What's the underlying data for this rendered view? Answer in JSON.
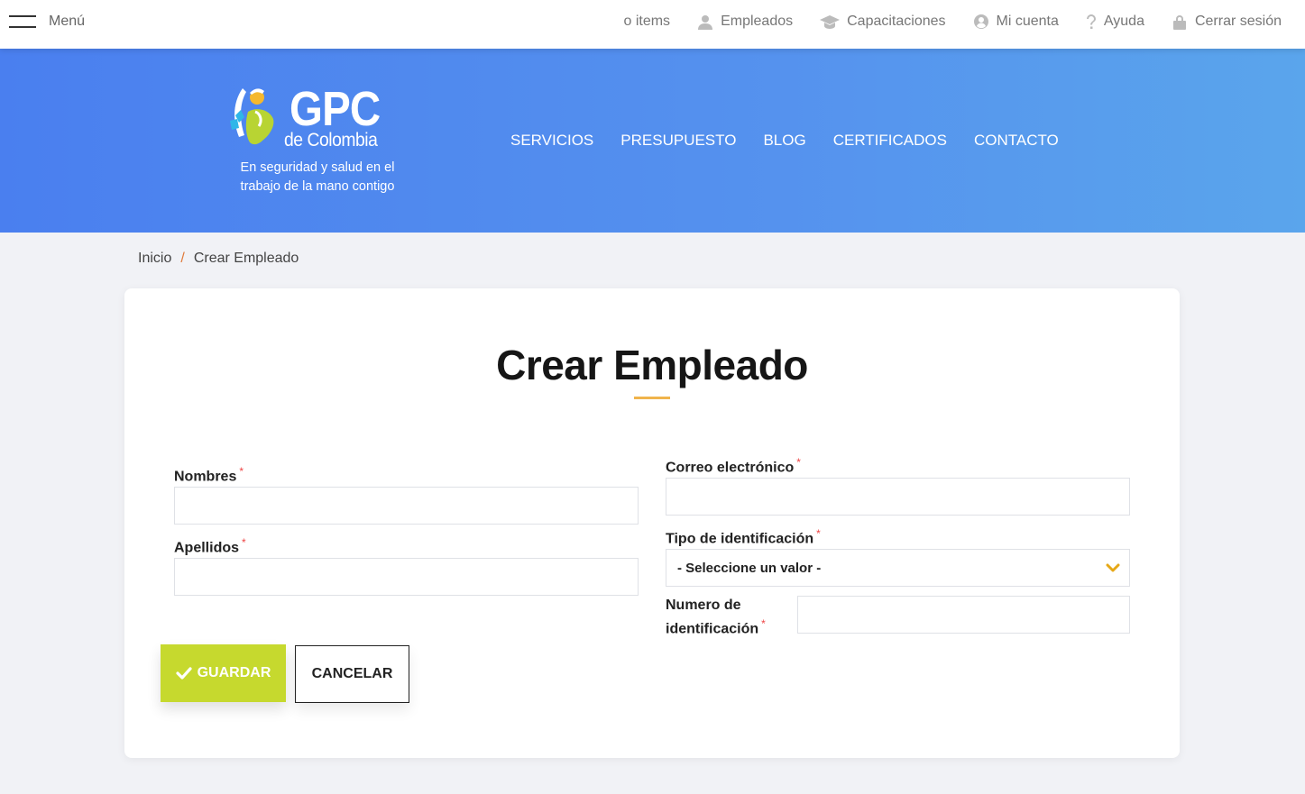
{
  "topbar": {
    "menu_label": "Menú",
    "links": [
      {
        "label": "o items",
        "icon": "none"
      },
      {
        "label": "Empleados",
        "icon": "user-icon"
      },
      {
        "label": "Capacitaciones",
        "icon": "graduation-cap-icon"
      },
      {
        "label": "Mi cuenta",
        "icon": "user-circle-icon"
      },
      {
        "label": "Ayuda",
        "icon": "question-icon"
      },
      {
        "label": "Cerrar sesión",
        "icon": "lock-icon"
      }
    ]
  },
  "header": {
    "logo_word": "GPC",
    "logo_sub": "de Colombia",
    "tagline": "En seguridad y salud en el trabajo de la mano contigo",
    "nav": [
      "SERVICIOS",
      "PRESUPUESTO",
      "BLOG",
      "CERTIFICADOS",
      "CONTACTO"
    ]
  },
  "breadcrumb": {
    "home": "Inicio",
    "separator": "/",
    "current": "Crear Empleado"
  },
  "form": {
    "title": "Crear Empleado",
    "required_mark": "*",
    "nombres_label": "Nombres",
    "nombres_value": "",
    "apellidos_label": "Apellidos",
    "apellidos_value": "",
    "correo_label": "Correo electrónico",
    "correo_value": "",
    "tipo_id_label": "Tipo de identificación",
    "tipo_id_selected": "- Seleccione un valor -",
    "numero_id_label": "Numero de identificación",
    "numero_id_value": "",
    "save_label": "GUARDAR",
    "cancel_label": "CANCELAR"
  },
  "colors": {
    "header_gradient_start": "#4a7fef",
    "header_gradient_end": "#5aa5ec",
    "save_button": "#c6d92e",
    "title_underline": "#f0b44c",
    "required": "#ee4444",
    "breadcrumb_separator": "#e07a3a",
    "select_chevron": "#e6a817"
  }
}
